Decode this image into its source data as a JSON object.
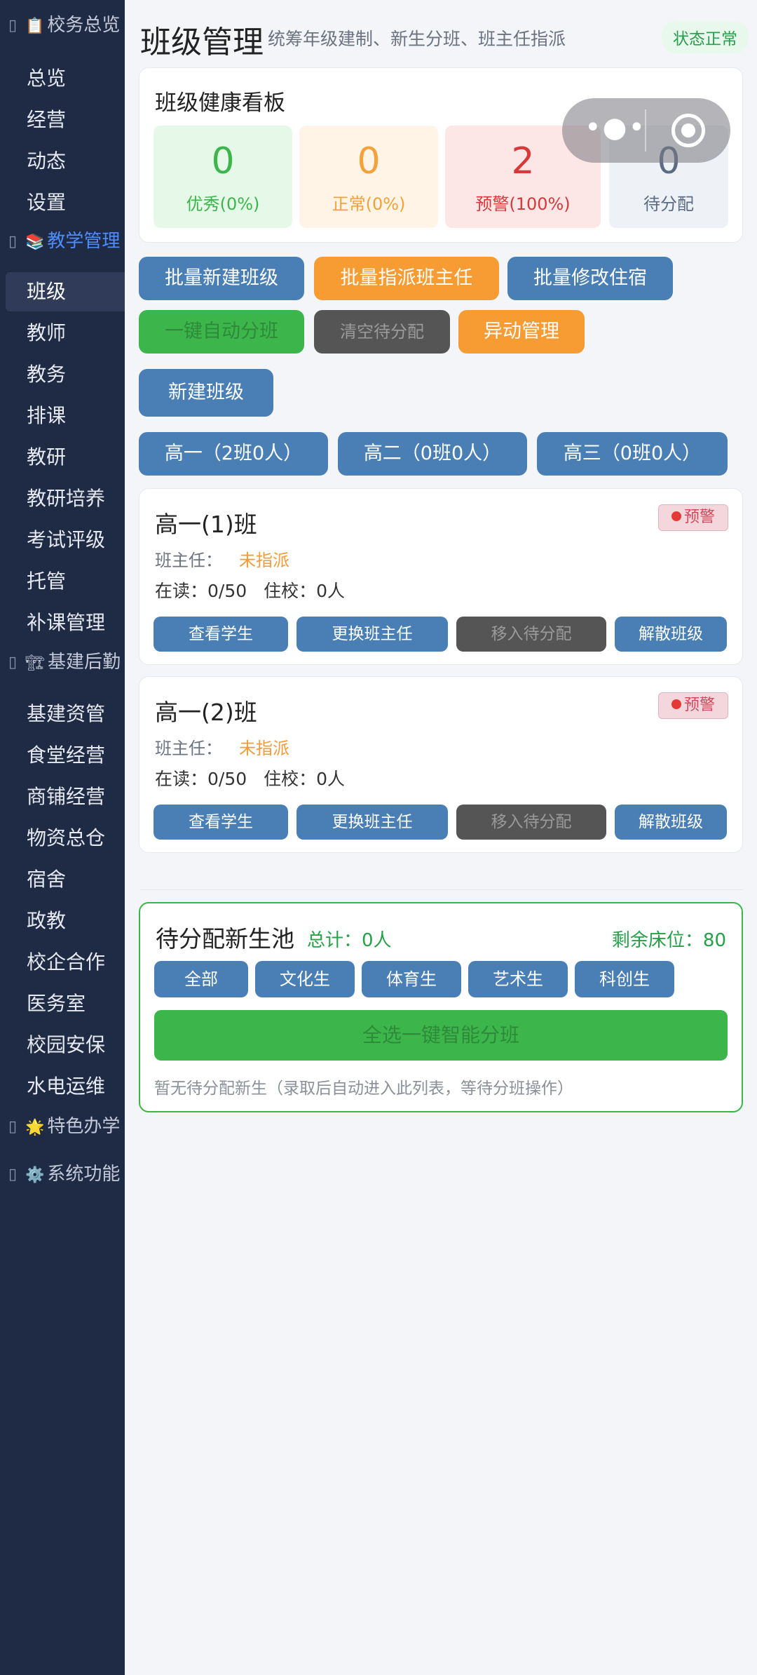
{
  "sidebar": {
    "groups": {
      "overview": {
        "emoji": "📋",
        "label": "校务总览"
      },
      "teaching": {
        "emoji": "📚",
        "label": "教学管理"
      },
      "logistics": {
        "emoji": "🏗",
        "label": "基建后勤"
      },
      "special": {
        "emoji": "🌟",
        "label": "特色办学"
      },
      "system": {
        "emoji": "⚙️",
        "label": "系统功能"
      }
    },
    "items": [
      "总览",
      "经营",
      "动态",
      "设置",
      "班级",
      "教师",
      "教务",
      "排课",
      "教研",
      "教研培养",
      "考试评级",
      "托管",
      "补课管理",
      "基建资管",
      "食堂经营",
      "商铺经营",
      "物资总仓",
      "宿舍",
      "政教",
      "校企合作",
      "医务室",
      "校园安保",
      "水电运维"
    ]
  },
  "header": {
    "title": "班级管理",
    "subtitle": "统筹年级建制、新生分班、班主任指派",
    "status": "状态正常"
  },
  "health": {
    "title": "班级健康看板",
    "stats": [
      {
        "value": "0",
        "label": "优秀(0%)"
      },
      {
        "value": "0",
        "label": "正常(0%)"
      },
      {
        "value": "2",
        "label": "预警(100%)"
      },
      {
        "value": "0",
        "label": "待分配"
      }
    ]
  },
  "actions": {
    "batch_create": "批量新建班级",
    "batch_assign": "批量指派班主任",
    "batch_dorm": "批量修改住宿",
    "auto_assign": "一键自动分班",
    "clear_pending": "清空待分配",
    "transfer": "异动管理",
    "new_class": "新建班级"
  },
  "grades": [
    "高一（2班0人）",
    "高二（0班0人）",
    "高三（0班0人）"
  ],
  "classes": [
    {
      "name": "高一(1)班",
      "warn": "预警",
      "teacher_label": "班主任：",
      "teacher_value": "未指派",
      "enrolled": "在读：0/50",
      "boarding": "住校：0人"
    },
    {
      "name": "高一(2)班",
      "warn": "预警",
      "teacher_label": "班主任：",
      "teacher_value": "未指派",
      "enrolled": "在读：0/50",
      "boarding": "住校：0人"
    }
  ],
  "class_buttons": {
    "view": "查看学生",
    "change": "更换班主任",
    "move": "移入待分配",
    "dissolve": "解散班级"
  },
  "pool": {
    "title": "待分配新生池",
    "total": "总计：0人",
    "beds": "剩余床位：80",
    "filters": [
      "全部",
      "文化生",
      "体育生",
      "艺术生",
      "科创生"
    ],
    "smart_button": "全选一键智能分班",
    "empty_text": "暂无待分配新生（录取后自动进入此列表，等待分班操作）"
  },
  "colors": {
    "sidebar_bg": "#1f2a44",
    "primary_blue": "#4a7fb5",
    "orange": "#f79b33",
    "green": "#3cb64a",
    "red": "#d9383a"
  }
}
